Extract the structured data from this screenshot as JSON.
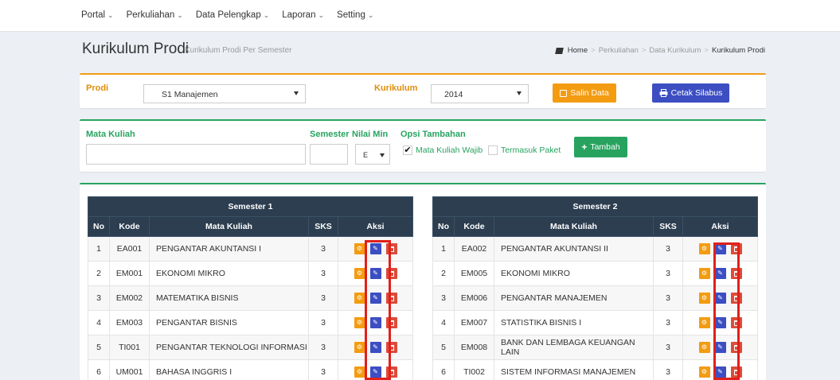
{
  "nav": {
    "items": [
      "Portal",
      "Perkuliahan",
      "Data Pelengkap",
      "Laporan",
      "Setting"
    ],
    "caret": "⌄"
  },
  "header": {
    "title": "Kurikulum Prodi",
    "subtitle": "Kurikulum Prodi Per Semester"
  },
  "breadcrumb": [
    "Home",
    "Perkuliahan",
    "Data Kurikulum",
    "Kurikulum Prodi"
  ],
  "filter": {
    "prodi_label": "Prodi",
    "prodi_value": "S1 Manajemen",
    "kurikulum_label": "Kurikulum",
    "kurikulum_value": "2014",
    "salin_label": "Salin Data",
    "cetak_label": "Cetak Silabus"
  },
  "form": {
    "matkul_label": "Mata Kuliah",
    "semester_label": "Semester",
    "nilai_min_label": "Nilai Min",
    "nilai_min_value": "E",
    "opsi_label": "Opsi Tambahan",
    "wajib_label": "Mata Kuliah Wajib",
    "paket_label": "Termasuk Paket",
    "tambah_label": "Tambah"
  },
  "columns": {
    "no": "No",
    "kode": "Kode",
    "matkul": "Mata Kuliah",
    "sks": "SKS",
    "aksi": "Aksi"
  },
  "semesters": [
    {
      "title": "Semester 1",
      "rows": [
        {
          "no": "1",
          "kode": "EA001",
          "nama": "PENGANTAR AKUNTANSI I",
          "sks": "3"
        },
        {
          "no": "2",
          "kode": "EM001",
          "nama": "EKONOMI MIKRO",
          "sks": "3"
        },
        {
          "no": "3",
          "kode": "EM002",
          "nama": "MATEMATIKA BISNIS",
          "sks": "3"
        },
        {
          "no": "4",
          "kode": "EM003",
          "nama": "PENGANTAR BISNIS",
          "sks": "3"
        },
        {
          "no": "5",
          "kode": "TI001",
          "nama": "PENGANTAR TEKNOLOGI INFORMASI",
          "sks": "3"
        },
        {
          "no": "6",
          "kode": "UM001",
          "nama": "BAHASA INGGRIS I",
          "sks": "3"
        }
      ]
    },
    {
      "title": "Semester 2",
      "rows": [
        {
          "no": "1",
          "kode": "EA002",
          "nama": "PENGANTAR AKUNTANSI II",
          "sks": "3"
        },
        {
          "no": "2",
          "kode": "EM005",
          "nama": "EKONOMI MIKRO",
          "sks": "3"
        },
        {
          "no": "3",
          "kode": "EM006",
          "nama": "PENGANTAR MANAJEMEN",
          "sks": "3"
        },
        {
          "no": "4",
          "kode": "EM007",
          "nama": "STATISTIKA BISNIS I",
          "sks": "3"
        },
        {
          "no": "5",
          "kode": "EM008",
          "nama": "BANK DAN LEMBAGA KEUANGAN LAIN",
          "sks": "3"
        },
        {
          "no": "6",
          "kode": "TI002",
          "nama": "SISTEM INFORMASI MANAJEMEN",
          "sks": "3"
        }
      ]
    }
  ],
  "colors": {
    "orange": "#f39c12",
    "green": "#27a35f",
    "blue": "#3c4ec2",
    "red": "#dd4b39",
    "header": "#2c3e50",
    "highlight": "#e0201b"
  }
}
